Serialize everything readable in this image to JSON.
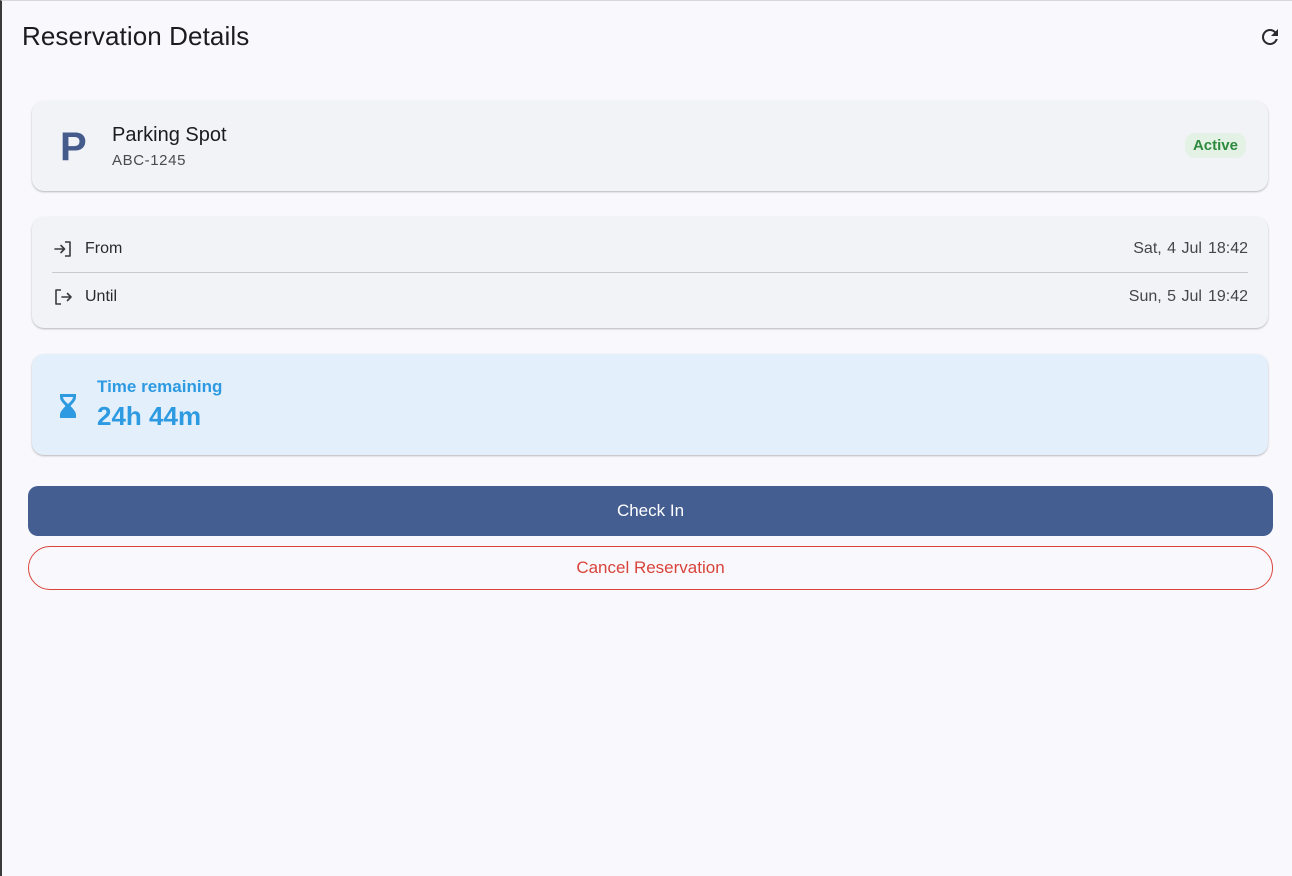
{
  "header": {
    "title": "Reservation Details",
    "refresh_icon": "refresh-icon"
  },
  "spot": {
    "icon_letter": "P",
    "title": "Parking Spot",
    "plate": "ABC-1245",
    "status": "Active",
    "status_color": "#2e8a3d"
  },
  "times": {
    "from_label": "From",
    "from_date": "Sat, 4 Jul",
    "from_time": "18:42",
    "from_icon": "login-icon",
    "until_label": "Until",
    "until_date": "Sun, 5 Jul",
    "until_time": "19:42",
    "until_icon": "logout-icon"
  },
  "remaining": {
    "label": "Time remaining",
    "value": "24h 44m",
    "icon": "hourglass-icon",
    "accent_color": "#2d9ae1"
  },
  "actions": {
    "check_in_label": "Check In",
    "cancel_label": "Cancel Reservation",
    "primary_color": "#445e92",
    "danger_color": "#d9443a"
  }
}
